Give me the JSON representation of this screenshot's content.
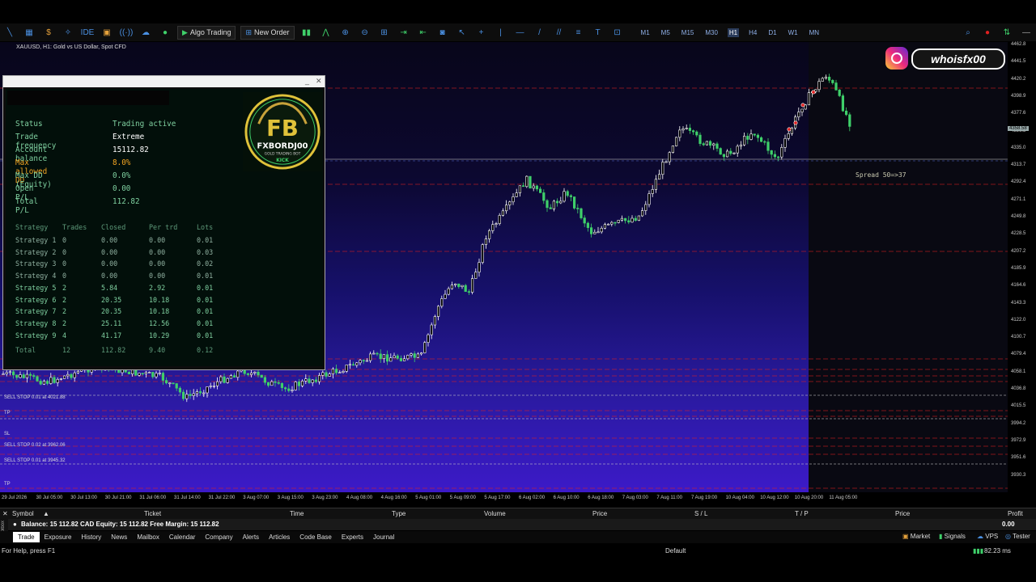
{
  "toolbar": {
    "algo_trading": "Algo Trading",
    "new_order": "New Order",
    "timeframes": [
      "M1",
      "M5",
      "M15",
      "M30",
      "H1",
      "H4",
      "D1",
      "W1",
      "MN"
    ],
    "active_timeframe": "H1"
  },
  "chart": {
    "symbol_title": "XAUUSD, H1: Gold vs US Dollar, Spot CFD",
    "spread_label": "Spread 50=>37",
    "current_price_tag": "4358.58",
    "price_ticks": [
      "4462.8",
      "4441.5",
      "4420.2",
      "4398.9",
      "4377.6",
      "4356.3",
      "4335.0",
      "4313.7",
      "4292.4",
      "4271.1",
      "4249.8",
      "4228.5",
      "4207.2",
      "4185.9",
      "4164.6",
      "4143.3",
      "4122.0",
      "4100.7",
      "4079.4",
      "4058.1",
      "4036.8",
      "4015.5",
      "3994.2",
      "3972.9",
      "3951.6",
      "3930.3"
    ],
    "time_ticks": [
      "29 Jul 2026",
      "30 Jul 05:00",
      "30 Jul 13:00",
      "30 Jul 21:00",
      "31 Jul 06:00",
      "31 Jul 14:00",
      "31 Jul 22:00",
      "3 Aug 07:00",
      "3 Aug 15:00",
      "3 Aug 23:00",
      "4 Aug 08:00",
      "4 Aug 16:00",
      "5 Aug 01:00",
      "5 Aug 09:00",
      "5 Aug 17:00",
      "6 Aug 02:00",
      "6 Aug 10:00",
      "6 Aug 18:00",
      "7 Aug 03:00",
      "7 Aug 11:00",
      "7 Aug 19:00",
      "10 Aug 04:00",
      "10 Aug 12:00",
      "10 Aug 20:00",
      "11 Aug 05:00"
    ],
    "order_labels": [
      "SELL STOP 0.01 at 4021.88",
      "TP",
      "SL",
      "SELL STOP 0.02 at 3962.06",
      "SELL STOP 0.01 at 3945.32",
      "TP"
    ]
  },
  "panel": {
    "rows": [
      {
        "k": "Status",
        "v": "Trading active",
        "c": "#7fd0a0"
      },
      {
        "k": "Trade frequency",
        "v": "Extreme",
        "c": "#ffffff"
      },
      {
        "k": "Account balance",
        "v": "15112.82",
        "c": "#ffffff"
      },
      {
        "k": "Max allowed DD",
        "v": "8.0%",
        "c": "#f5a623"
      },
      {
        "k": "Max DD (Equity)",
        "v": "0.0%",
        "c": "#7fd0a0"
      },
      {
        "k": "Open P/L",
        "v": "0.00",
        "c": "#7fd0a0"
      },
      {
        "k": "Total P/L",
        "v": "112.82",
        "c": "#7fd0a0"
      }
    ],
    "table_headers": [
      "Strategy",
      "Trades",
      "Closed",
      "Per trd",
      "Lots"
    ],
    "strategies": [
      [
        "Strategy 1",
        "0",
        "0.00",
        "0.00",
        "0.01"
      ],
      [
        "Strategy 2",
        "0",
        "0.00",
        "0.00",
        "0.03"
      ],
      [
        "Strategy 3",
        "0",
        "0.00",
        "0.00",
        "0.02"
      ],
      [
        "Strategy 4",
        "0",
        "0.00",
        "0.00",
        "0.01"
      ],
      [
        "Strategy 5",
        "2",
        "5.84",
        "2.92",
        "0.01"
      ],
      [
        "Strategy 6",
        "2",
        "20.35",
        "10.18",
        "0.01"
      ],
      [
        "Strategy 7",
        "2",
        "20.35",
        "10.18",
        "0.01"
      ],
      [
        "Strategy 8",
        "2",
        "25.11",
        "12.56",
        "0.01"
      ],
      [
        "Strategy 9",
        "4",
        "41.17",
        "10.29",
        "0.01"
      ]
    ],
    "total": [
      "Total",
      "12",
      "112.82",
      "9.40",
      "0.12"
    ],
    "logo_text": "FXBORDJ00",
    "logo_sub": "GOLD TRADING BOT",
    "logo_kick": "KICK"
  },
  "instagram": {
    "handle": "whoisfx00"
  },
  "terminal": {
    "headers": [
      "Symbol",
      "Ticket",
      "Time",
      "Type",
      "Volume",
      "Price",
      "S / L",
      "T / P",
      "Price",
      "Profit"
    ],
    "balance_line": "Balance: 15 112.82 CAD  Equity: 15 112.82  Free Margin: 15 112.82",
    "profit_total": "0.00",
    "tabs": [
      "Trade",
      "Exposure",
      "History",
      "News",
      "Mailbox",
      "Calendar",
      "Company",
      "Alerts",
      "Articles",
      "Code Base",
      "Experts",
      "Journal"
    ],
    "active_tab": "Trade",
    "side_label": "Toolbox",
    "right_tools": [
      "Market",
      "Signals",
      "VPS",
      "Tester"
    ]
  },
  "status": {
    "help": "For Help, press F1",
    "profile": "Default",
    "ping": "82.23 ms"
  },
  "colors": {
    "bull": "#ffffff",
    "bear": "#3fd06a",
    "red_line": "#e02020"
  }
}
